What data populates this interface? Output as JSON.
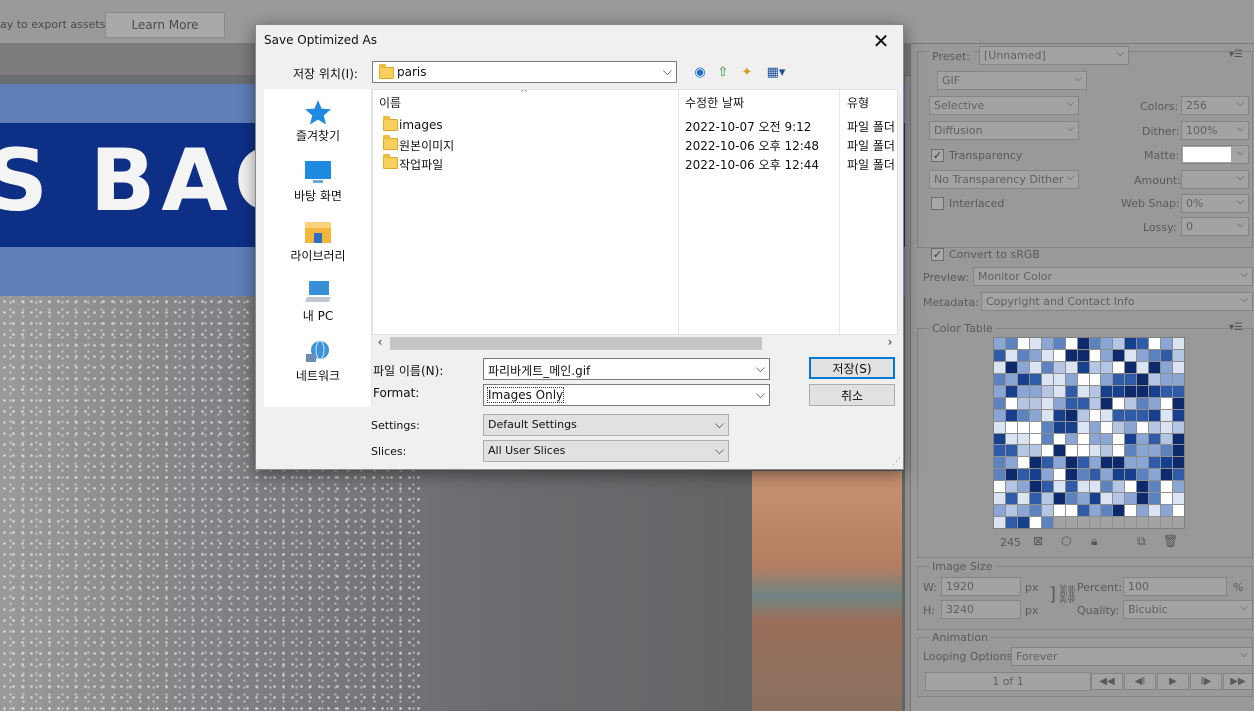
{
  "background_app": {
    "topbar_hint": "ay to export assets",
    "learn_more_label": "Learn More",
    "banner_text": "S BAG"
  },
  "optimize_panel": {
    "preset_label": "Preset:",
    "preset_value": "[Unnamed]",
    "format_value": "GIF",
    "reduction_value": "Selective",
    "dither_algo_value": "Diffusion",
    "transparency_label": "Transparency",
    "transparency_checked": true,
    "trans_dither_value": "No Transparency Dither",
    "interlaced_label": "Interlaced",
    "interlaced_checked": false,
    "colors_label": "Colors:",
    "colors_value": "256",
    "dither_label": "Dither:",
    "dither_value": "100%",
    "matte_label": "Matte:",
    "amount_label": "Amount:",
    "websnap_label": "Web Snap:",
    "websnap_value": "0%",
    "lossy_label": "Lossy:",
    "lossy_value": "0",
    "convert_srgb_label": "Convert to sRGB",
    "convert_srgb_checked": true,
    "preview_label": "Preview:",
    "preview_value": "Monitor Color",
    "metadata_label": "Metadata:",
    "metadata_value": "Copyright and Contact Info",
    "color_table_title": "Color Table",
    "color_count": "245",
    "image_size_title": "Image Size",
    "w_label": "W:",
    "w_value": "1920",
    "h_label": "H:",
    "h_value": "3240",
    "px_unit": "px",
    "percent_label": "Percent:",
    "percent_value": "100",
    "percent_unit": "%",
    "quality_label": "Quality:",
    "quality_value": "Bicubic",
    "animation_title": "Animation",
    "looping_label": "Looping Options:",
    "looping_value": "Forever",
    "frame_counter": "1 of 1",
    "palette_colors": [
      "#ffffff",
      "#dbe4f2",
      "#b4c6e4",
      "#8aa6d4",
      "#5d82c0",
      "#2f5ba8",
      "#163f8e",
      "#0c2a6c"
    ]
  },
  "dialog": {
    "title": "Save Optimized As",
    "close_glyph": "✕",
    "location_label": "저장 위치(I):",
    "location_value": "paris",
    "places": [
      {
        "label": "즐겨찾기"
      },
      {
        "label": "바탕 화면"
      },
      {
        "label": "라이브러리"
      },
      {
        "label": "내 PC"
      },
      {
        "label": "네트워크"
      }
    ],
    "columns": {
      "name": "이름",
      "modified": "수정한 날짜",
      "type": "유형"
    },
    "files": [
      {
        "name": "images",
        "modified": "2022-10-07 오전 9:12",
        "type": "파일 폴더"
      },
      {
        "name": "원본이미지",
        "modified": "2022-10-06 오후 12:48",
        "type": "파일 폴더"
      },
      {
        "name": "작업파일",
        "modified": "2022-10-06 오후 12:44",
        "type": "파일 폴더"
      }
    ],
    "filename_label": "파일 이름(N):",
    "filename_value": "파리바게트_메인.gif",
    "format_label": "Format:",
    "format_value": "Images Only",
    "settings_label": "Settings:",
    "settings_value": "Default Settings",
    "slices_label": "Slices:",
    "slices_value": "All User Slices",
    "save_label": "저장(S)",
    "cancel_label": "취소"
  }
}
